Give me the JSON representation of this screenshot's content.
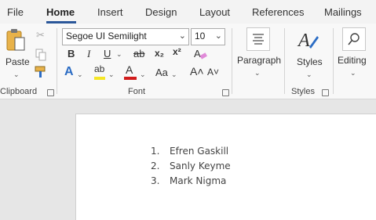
{
  "tabs": [
    {
      "label": "File"
    },
    {
      "label": "Home"
    },
    {
      "label": "Insert"
    },
    {
      "label": "Design"
    },
    {
      "label": "Layout"
    },
    {
      "label": "References"
    },
    {
      "label": "Mailings"
    }
  ],
  "clipboard": {
    "paste_label": "Paste",
    "group_label": "Clipboard"
  },
  "font": {
    "name_value": "Segoe UI Semilight",
    "size_value": "10",
    "group_label": "Font",
    "bold": "B",
    "italic": "I",
    "underline": "U",
    "strike": "ab",
    "subscript": "x₂",
    "superscript": "x²",
    "text_effects": "A",
    "highlight": "ab",
    "font_color": "A",
    "change_case": "Aa",
    "grow": "A˄",
    "shrink": "A˅",
    "highlight_color": "#f5e625",
    "font_color_bar": "#d11c1c",
    "effects_color": "#2b6cc4"
  },
  "paragraph": {
    "label": "Paragraph"
  },
  "styles": {
    "label": "Styles",
    "group_label": "Styles"
  },
  "editing": {
    "label": "Editing"
  },
  "accent": "#2b579a",
  "document": {
    "list": [
      {
        "num": "1.",
        "text": "Efren Gaskill"
      },
      {
        "num": "2.",
        "text": "Sanly Keyme"
      },
      {
        "num": "3.",
        "text": "Mark Nigma"
      }
    ]
  }
}
